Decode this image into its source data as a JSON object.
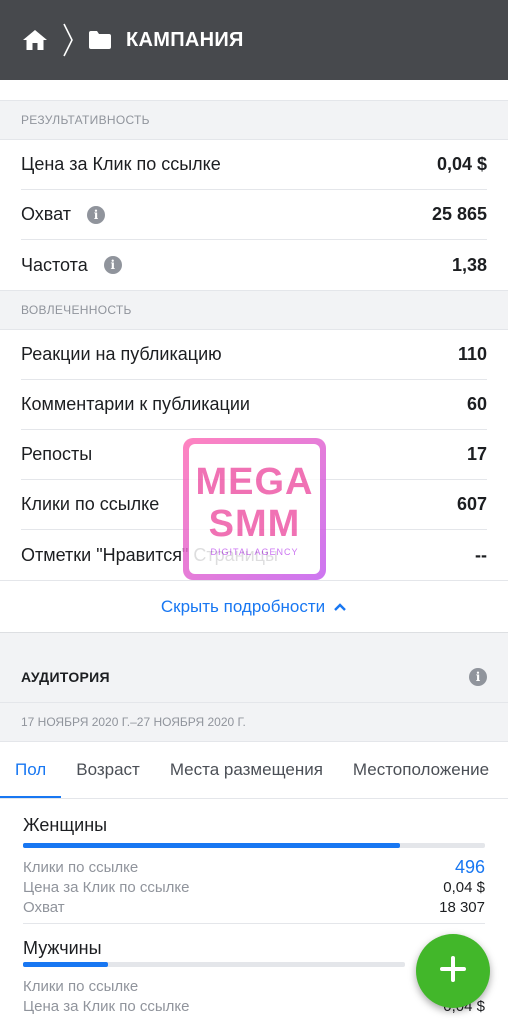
{
  "header": {
    "title": "КАМПАНИЯ"
  },
  "performance": {
    "heading": "РЕЗУЛЬТАТИВНОСТЬ",
    "rows": [
      {
        "label": "Цена за Клик по ссылке",
        "value": "0,04 $"
      },
      {
        "label": "Охват",
        "value": "25 865"
      },
      {
        "label": "Частота",
        "value": "1,38"
      }
    ]
  },
  "engagement": {
    "heading": "ВОВЛЕЧЕННОСТЬ",
    "rows": [
      {
        "label": "Реакции на публикацию",
        "value": "110"
      },
      {
        "label": "Комментарии к публикации",
        "value": "60"
      },
      {
        "label": "Репосты",
        "value": "17"
      },
      {
        "label": "Клики по ссылке",
        "value": "607"
      },
      {
        "label": "Отметки \"Нравится\" Страницы",
        "value": "--"
      }
    ]
  },
  "toggle_details": "Скрыть подробности",
  "audience": {
    "heading": "АУДИТОРИЯ",
    "date_range": "17 НОЯБРЯ 2020 Г.–27 НОЯБРЯ 2020 Г.",
    "tabs": [
      "Пол",
      "Возраст",
      "Места размещения",
      "Местоположение"
    ],
    "groups": [
      {
        "name": "Женщины",
        "bar_fraction": 0.817,
        "stats": [
          {
            "label": "Клики по ссылке",
            "value": "496"
          },
          {
            "label": "Цена за Клик по ссылке",
            "value": "0,04 $"
          },
          {
            "label": "Охват",
            "value": "18 307"
          }
        ]
      },
      {
        "name": "Мужчины",
        "bar_fraction": 0.183,
        "stats": [
          {
            "label": "Клики по ссылке",
            "value": ""
          },
          {
            "label": "Цена за Клик по ссылке",
            "value": "0,04 $"
          }
        ]
      }
    ]
  },
  "watermark": {
    "title_line1": "MEGA",
    "title_line2": "SMM",
    "subtitle": "DIGITAL AGENCY"
  },
  "colors": {
    "header_bg": "#47494d",
    "accent": "#1877f2",
    "fab": "#42b72a"
  },
  "icons": {
    "home": "home-icon",
    "chevron": "chevron-right-icon",
    "folder": "folder-icon",
    "info": "info-icon",
    "add": "plus-icon"
  }
}
